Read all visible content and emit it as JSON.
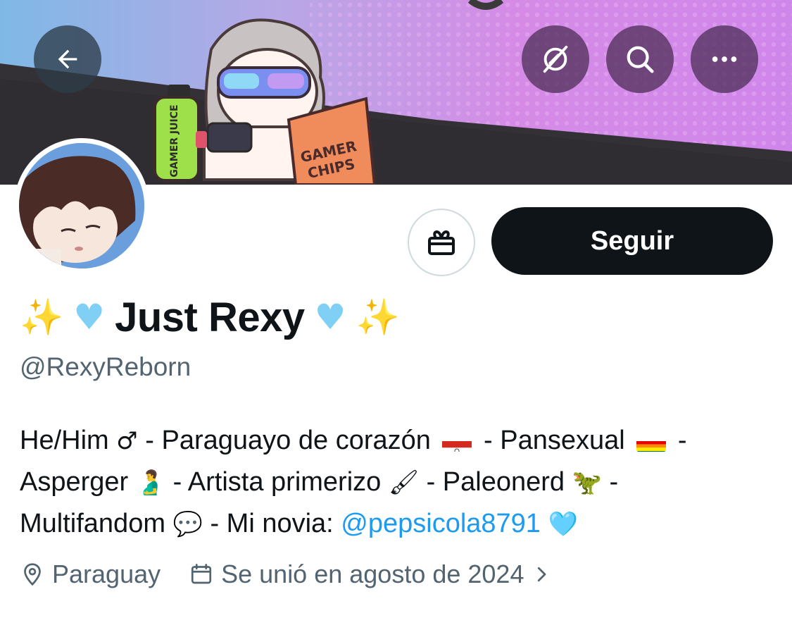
{
  "header": {
    "back_icon": "arrow-left-icon",
    "right_icons": [
      "no-algorithm-icon",
      "search-icon",
      "more-icon"
    ]
  },
  "banner": {
    "juice_label": "GAMER JUICE",
    "chips_label": "GAMER CHIPS"
  },
  "actions": {
    "gift_icon": "gift-icon",
    "follow_label": "Seguir"
  },
  "profile": {
    "name": "Just Rexy",
    "name_prefix": "✨ 🩵",
    "name_suffix": "🩵 ✨",
    "handle": "@RexyReborn"
  },
  "bio": {
    "line1_a": "He/Him",
    "line1_sym": "♂",
    "line1_b": " - Paraguayo de corazón",
    "line1_c": " - Pansexual",
    "line1_d": " -",
    "line2_a": "Asperger",
    "line2_sym": "🫃",
    "line2_b": " - Artista primerizo",
    "line2_sym2": "🖌",
    "line2_c": "- Paleonerd",
    "line2_sym3": "🦖",
    "line2_d": " -",
    "line3_a": "Multifandom",
    "line3_sym": "💬",
    "line3_b": " - Mi novia: ",
    "mention": "@pepsicola8791",
    "line3_sym2": "🩵"
  },
  "meta": {
    "location": "Paraguay",
    "joined": "Se unió en agosto de 2024",
    "location_icon": "location-pin-icon",
    "calendar_icon": "calendar-icon",
    "chevron_icon": "chevron-right-icon"
  },
  "colors": {
    "follow_bg": "#0f1419",
    "mention": "#1d9bf0",
    "secondary_text": "#536471",
    "banner_pink": "#d98de8",
    "banner_blue": "#8fc0e4"
  }
}
